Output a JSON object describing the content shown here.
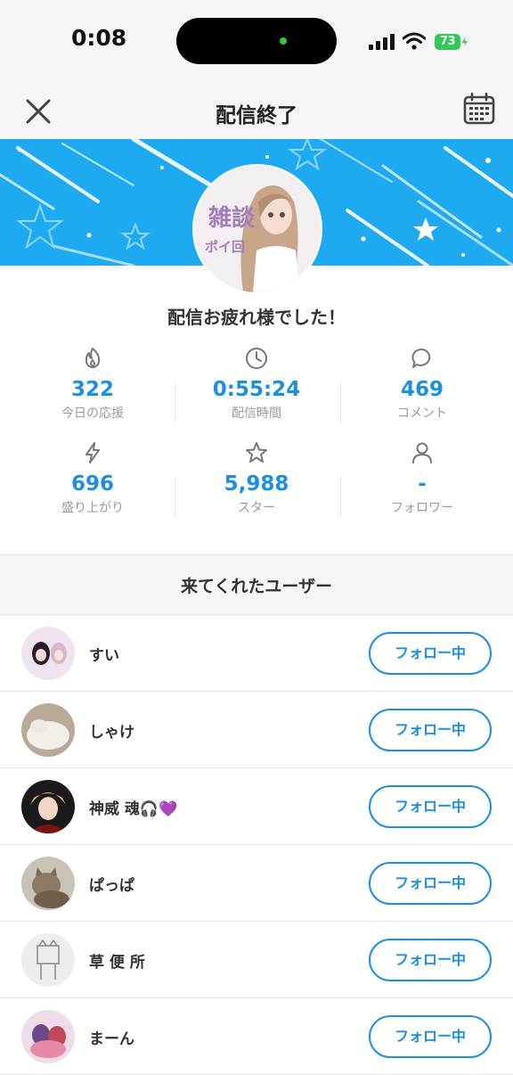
{
  "status_bar": {
    "time": "0:08",
    "battery": "73"
  },
  "header": {
    "title": "配信終了"
  },
  "banner": {
    "thumbnail_line1": "雑談",
    "thumbnail_line2": "ポイ回"
  },
  "summary": {
    "title": "配信お疲れ様でした！",
    "stats": [
      {
        "icon": "flame-icon",
        "value": "322",
        "label": "今日の応援"
      },
      {
        "icon": "clock-icon",
        "value": "0:55:24",
        "label": "配信時間"
      },
      {
        "icon": "comment-icon",
        "value": "469",
        "label": "コメント"
      },
      {
        "icon": "lightning-icon",
        "value": "696",
        "label": "盛り上がり"
      },
      {
        "icon": "star-icon",
        "value": "5,988",
        "label": "スター"
      },
      {
        "icon": "person-icon",
        "value": "-",
        "label": "フォロワー"
      }
    ]
  },
  "visitors": {
    "title": "来てくれたユーザー",
    "users": [
      {
        "name": "すい",
        "button": "フォロー中"
      },
      {
        "name": "しゃけ",
        "button": "フォロー中"
      },
      {
        "name": "神威 魂🎧💜",
        "button": "フォロー中"
      },
      {
        "name": "ぱっぱ",
        "button": "フォロー中"
      },
      {
        "name": "草 便 所",
        "button": "フォロー中"
      },
      {
        "name": "まーん",
        "button": "フォロー中"
      }
    ]
  },
  "colors": {
    "accent": "#1c8fe0",
    "banner": "#1eaaf1",
    "header_bg": "#f6f6f7"
  }
}
